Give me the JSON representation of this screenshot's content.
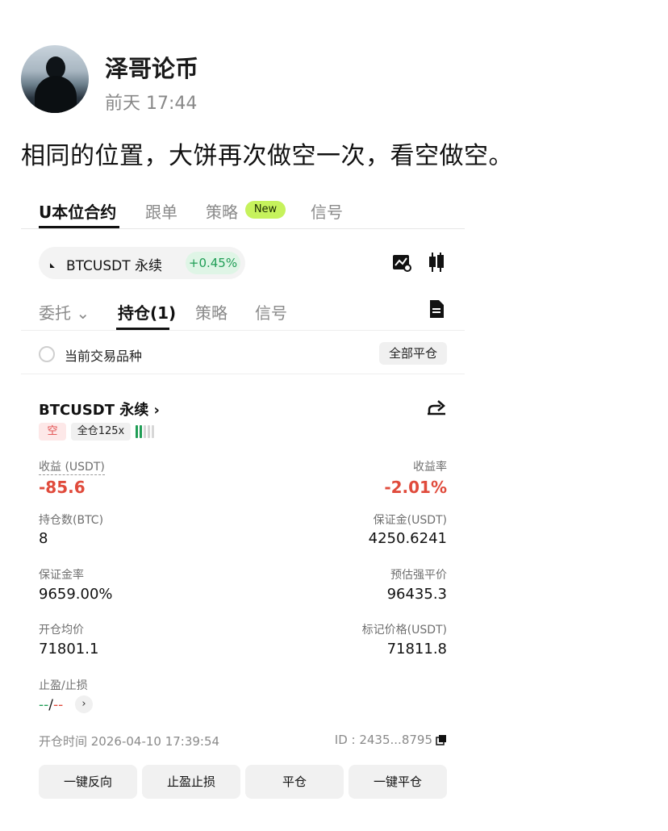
{
  "post": {
    "author": "泽哥论币",
    "time": "前天 17:44",
    "text": "相同的位置，大饼再次做空一次，看空做空。"
  },
  "app": {
    "top_tabs": [
      {
        "label": "U本位合约",
        "active": true
      },
      {
        "label": "跟单",
        "active": false
      },
      {
        "label": "策略",
        "active": false
      },
      {
        "label": "信号",
        "active": false
      }
    ],
    "new_badge": "New",
    "symbol": {
      "name": "BTCUSDT 永续",
      "change": "+0.45%"
    },
    "sub_tabs": [
      {
        "label": "委托",
        "active": false
      },
      {
        "label": "持仓(1)",
        "active": true
      },
      {
        "label": "策略",
        "active": false
      },
      {
        "label": "信号",
        "active": false
      }
    ],
    "filter": {
      "label": "当前交易品种",
      "close_all": "全部平仓"
    },
    "position": {
      "title": "BTCUSDT 永续 ›",
      "side_tag": "空",
      "margin_tag": "全仓125x",
      "pnl_label": "收益 (USDT)",
      "pnl_value": "-85.6",
      "roe_label": "收益率",
      "roe_value": "-2.01%",
      "size_label": "持仓数(BTC)",
      "size_value": "8",
      "margin_label": "保证金(USDT)",
      "margin_value": "4250.6241",
      "margin_ratio_label": "保证金率",
      "margin_ratio_value": "9659.00%",
      "liq_label": "预估强平价",
      "liq_value": "96435.3",
      "entry_label": "开仓均价",
      "entry_value": "71801.1",
      "mark_label": "标记价格(USDT)",
      "mark_value": "71811.8",
      "tpsl_label": "止盈/止损",
      "tpsl_tp": "--",
      "tpsl_sep": "/",
      "tpsl_sl": "--",
      "open_time": "开仓时间 2026-04-10 17:39:54",
      "order_id": "ID : 2435...8795"
    },
    "actions": {
      "reverse": "一键反向",
      "tpsl": "止盈止损",
      "close": "平仓",
      "close_all": "一键平仓"
    },
    "colors": {
      "loss": "#e04b3c",
      "gain": "#1f9d55",
      "new_badge": "#c6f25c"
    }
  }
}
